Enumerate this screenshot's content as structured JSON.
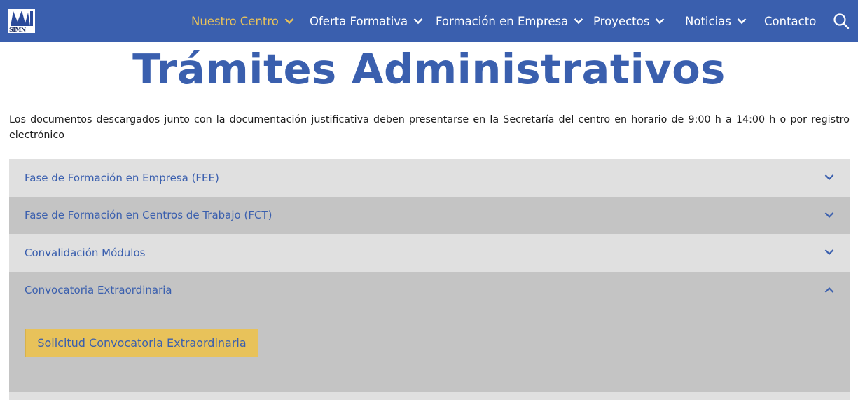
{
  "header": {
    "logo_text": "SIMN",
    "nav": [
      {
        "label": "Nuestro Centro",
        "active": true
      },
      {
        "label": "Oferta Formativa"
      },
      {
        "label": "Formación en Empresa"
      },
      {
        "label": "Proyectos"
      },
      {
        "label": "Noticias"
      },
      {
        "label": "Contacto"
      }
    ],
    "search_icon": "search-icon"
  },
  "page": {
    "title": "Trámites Administrativos",
    "intro": "Los documentos descargados junto con la documentación justificativa deben presentarse en la Secretaría del centro en horario de 9:00 h a 14:00 h o por registro electrónico"
  },
  "accordion": {
    "items": [
      {
        "title": "Fase de Formación en Empresa (FEE)",
        "expanded": false
      },
      {
        "title": "Fase de Formación en Centros de Trabajo (FCT)",
        "expanded": false
      },
      {
        "title": "Convalidación Módulos",
        "expanded": false
      },
      {
        "title": "Convocatoria Extraordinaria",
        "expanded": true,
        "button_label": "Solicitud Convocatoria Extraordinaria"
      }
    ]
  },
  "colors": {
    "brand_blue": "#3a5fae",
    "accent_yellow": "#e8c25a",
    "panel_light": "#e0e0e0",
    "panel_dark": "#c4c4c4"
  }
}
